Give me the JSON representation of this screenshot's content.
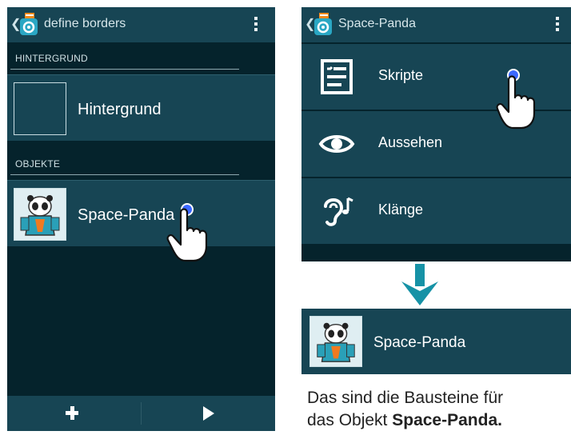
{
  "left_screen": {
    "title": "define borders",
    "back_glyph": "❮",
    "sections": {
      "background_header": "HINTERGRUND",
      "objects_header": "OBJEKTE"
    },
    "background_item": {
      "label": "Hintergrund"
    },
    "object_item": {
      "label": "Space-Panda"
    },
    "bottom_bar": {
      "add_icon": "plus-icon",
      "play_icon": "play-icon"
    }
  },
  "right_screen": {
    "title": "Space-Panda",
    "back_glyph": "❮",
    "menu": [
      {
        "label": "Skripte",
        "icon": "scripts-list-icon"
      },
      {
        "label": "Aussehen",
        "icon": "eye-icon"
      },
      {
        "label": "Klänge",
        "icon": "ear-music-icon"
      }
    ]
  },
  "result": {
    "label": "Space-Panda"
  },
  "caption": {
    "line1": "Das sind die Bausteine für",
    "line2_prefix": "das Objekt ",
    "line2_bold": "Space-Panda."
  },
  "colors": {
    "bar": "#174554",
    "background": "#05232c",
    "arrow": "#1692a6",
    "touch_dot": "#3b68ff"
  }
}
